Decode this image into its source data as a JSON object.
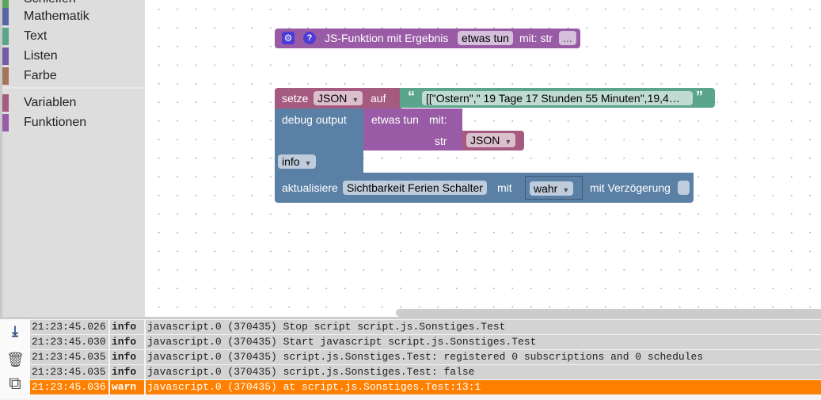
{
  "sidebar": {
    "categories": [
      {
        "label": "Schleifen",
        "color": "#5ba55b"
      },
      {
        "label": "Mathematik",
        "color": "#5b67a5"
      },
      {
        "label": "Text",
        "color": "#5ba58c"
      },
      {
        "label": "Listen",
        "color": "#745ba5"
      },
      {
        "label": "Farbe",
        "color": "#a5745b"
      },
      {
        "label": "Variablen",
        "color": "#a55b80"
      },
      {
        "label": "Funktionen",
        "color": "#995ba5"
      }
    ]
  },
  "blocks": {
    "function_def": {
      "title": "JS-Funktion mit Ergebnis",
      "name": "etwas tun",
      "params_label": "mit: str",
      "more": "..."
    },
    "set_var": {
      "label": "setze",
      "var": "JSON",
      "to": "auf",
      "open_quote": "“",
      "close_quote": "”",
      "text_value": "[[\"Ostern\",\" 19 Tage 17 Stunden 55 Minuten\",19,4…"
    },
    "debug": {
      "label": "debug output",
      "level": "info"
    },
    "call": {
      "name": "etwas tun",
      "with": "mit:",
      "param": "str",
      "arg": "JSON"
    },
    "update": {
      "label": "aktualisiere",
      "target": "Sichtbarkeit Ferien Schalter",
      "with": "mit",
      "value": "wahr",
      "delay_label": "mit Verzögerung"
    }
  },
  "log": {
    "icons": [
      "scroll-down-icon",
      "trash-icon",
      "copy-icon"
    ],
    "rows": [
      {
        "time": "21:23:45.026",
        "level": "info",
        "message": "javascript.0 (370435) Stop script script.js.Sonstiges.Test"
      },
      {
        "time": "21:23:45.030",
        "level": "info",
        "message": "javascript.0 (370435) Start javascript script.js.Sonstiges.Test"
      },
      {
        "time": "21:23:45.035",
        "level": "info",
        "message": "javascript.0 (370435) script.js.Sonstiges.Test: registered 0 subscriptions and 0 schedules"
      },
      {
        "time": "21:23:45.035",
        "level": "info",
        "message": "javascript.0 (370435) script.js.Sonstiges.Test: false"
      },
      {
        "time": "21:23:45.036",
        "level": "warn",
        "message": "javascript.0 (370435) at script.js.Sonstiges.Test:13:1"
      }
    ],
    "warn_color": "#ff8000"
  }
}
